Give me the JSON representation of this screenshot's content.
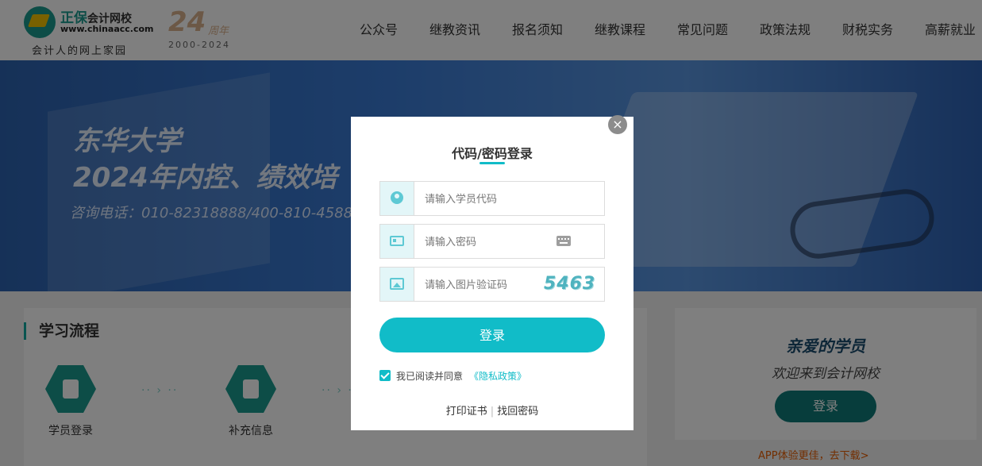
{
  "header": {
    "logo": {
      "brand": "正保",
      "brand_sub": "会计网校",
      "url": "www.chinaacc.com",
      "slogan": "会计人的网上家园"
    },
    "anniversary": {
      "number": "24",
      "unit": "周年",
      "years": "2000-2024"
    },
    "nav": [
      "公众号",
      "继教资讯",
      "报名须知",
      "继教课程",
      "常见问题",
      "政策法规",
      "财税实务",
      "高薪就业"
    ]
  },
  "banner": {
    "title_line1": "东华大学",
    "title_line2": "2024年内控、绩效培",
    "phone": "咨询电话：010-82318888/400-810-4588"
  },
  "content": {
    "section_title": "学习流程",
    "steps": [
      "学员登录",
      "补充信息"
    ],
    "arrow": "·· › ··"
  },
  "side": {
    "title": "亲爱的学员",
    "subtitle": "欢迎来到会计网校",
    "login_label": "登录",
    "app_link": "APP体验更佳，去下载>"
  },
  "modal": {
    "close_label": "×",
    "title": "代码/密码登录",
    "fields": {
      "student_code": {
        "placeholder": "请输入学员代码",
        "value": ""
      },
      "password": {
        "placeholder": "请输入密码",
        "value": ""
      },
      "captcha": {
        "placeholder": "请输入图片验证码",
        "value": ""
      }
    },
    "captcha_code": "5463",
    "login_label": "登录",
    "agree": {
      "checked": true,
      "text": "我已阅读并同意",
      "link": "《隐私政策》"
    },
    "bottom_links": {
      "print": "打印证书",
      "separator": "|",
      "recover": "找回密码"
    }
  },
  "colors": {
    "accent": "#11bcc8",
    "brand": "#1a9b8f",
    "overlay": "rgba(0,0,0,0.5)"
  }
}
